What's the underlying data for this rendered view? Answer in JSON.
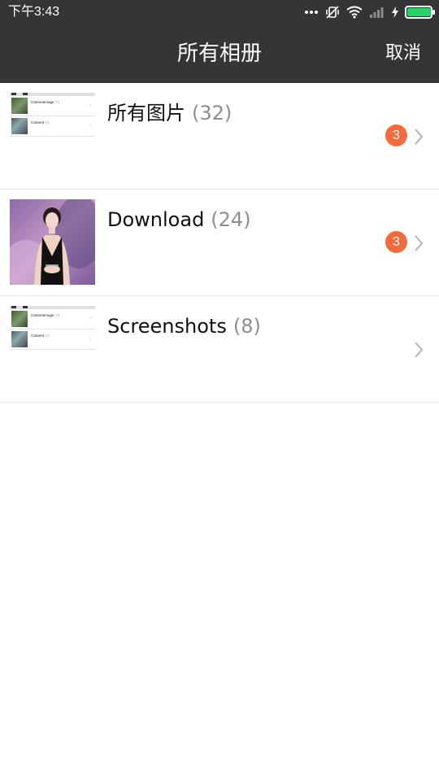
{
  "status_bar": {
    "time": "下午3:43",
    "icons": [
      "more-dots-icon",
      "vibrate-off-icon",
      "wifi-icon",
      "signal-icon",
      "charging-bolt-icon",
      "battery-icon"
    ],
    "battery_level": 0.95,
    "battery_color": "#25d366"
  },
  "header": {
    "title": "所有相册",
    "cancel_label": "取消",
    "background": "#333537"
  },
  "albums": [
    {
      "name": "所有图片",
      "count": "(32)",
      "badge": "3",
      "thumbnail": "screenshot-preview"
    },
    {
      "name": "Download",
      "count": "(24)",
      "badge": "3",
      "thumbnail": "photo-woman-black-dress"
    },
    {
      "name": "Screenshots",
      "count": "(8)",
      "badge": "",
      "thumbnail": "screenshot-preview"
    }
  ],
  "thumbnail_preview": {
    "rows": [
      {
        "name": "CameraImage",
        "count": "(7)"
      },
      {
        "name": "Camera",
        "count": "(1)"
      }
    ]
  },
  "colors": {
    "badge": "#f26b3a",
    "count_text": "#8e8e8e",
    "divider": "#e3e3e3"
  }
}
